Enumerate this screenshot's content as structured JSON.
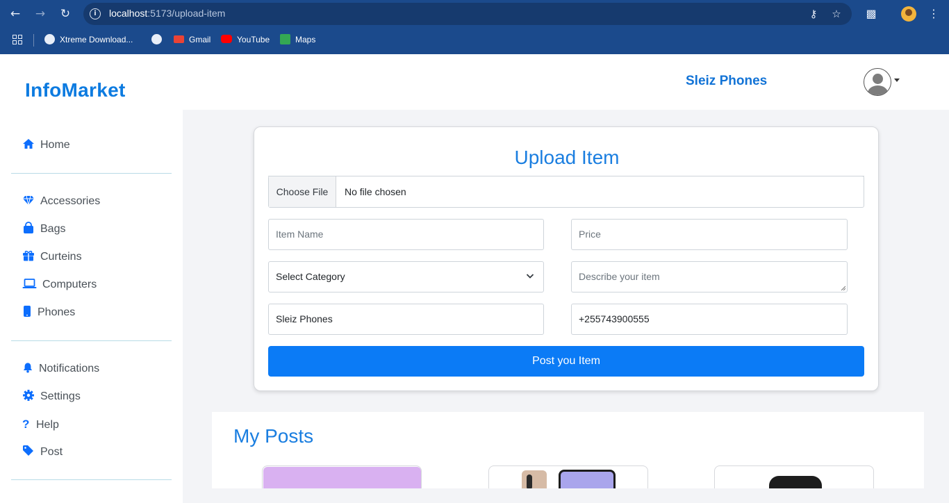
{
  "browser": {
    "url_host": "localhost",
    "url_path": ":5173/upload-item",
    "bookmarks": [
      {
        "label": "Xtreme Download...",
        "icon": "globe-icon"
      },
      {
        "label": "",
        "icon": "globe-icon"
      },
      {
        "label": "Gmail",
        "icon": "gmail-icon"
      },
      {
        "label": "YouTube",
        "icon": "youtube-icon"
      },
      {
        "label": "Maps",
        "icon": "maps-icon"
      }
    ]
  },
  "app": {
    "brand": "InfoMarket",
    "store_name": "Sleiz Phones"
  },
  "sidebar": {
    "groups": [
      [
        {
          "label": "Home",
          "icon": "home-icon"
        }
      ],
      [
        {
          "label": "Accessories",
          "icon": "gem-icon"
        },
        {
          "label": "Bags",
          "icon": "bag-icon"
        },
        {
          "label": "Curteins",
          "icon": "gift-icon"
        },
        {
          "label": "Computers",
          "icon": "laptop-icon"
        },
        {
          "label": "Phones",
          "icon": "phone-icon"
        }
      ],
      [
        {
          "label": "Notifications",
          "icon": "bell-icon"
        },
        {
          "label": "Settings",
          "icon": "gear-icon"
        },
        {
          "label": "Help",
          "icon": "question-icon"
        },
        {
          "label": "Post",
          "icon": "tag-icon"
        }
      ]
    ]
  },
  "upload_form": {
    "title": "Upload Item",
    "file_button": "Choose File",
    "file_status": "No file chosen",
    "item_name_placeholder": "Item Name",
    "price_placeholder": "Price",
    "category_selected": "Select Category",
    "description_placeholder": "Describe your item",
    "store_value": "Sleiz Phones",
    "phone_value": "+255743900555",
    "submit_label": "Post you Item"
  },
  "my_posts": {
    "title": "My Posts"
  },
  "colors": {
    "chrome": "#1b4a8c",
    "accent": "#0b7bf6",
    "brand": "#0d7be0"
  }
}
